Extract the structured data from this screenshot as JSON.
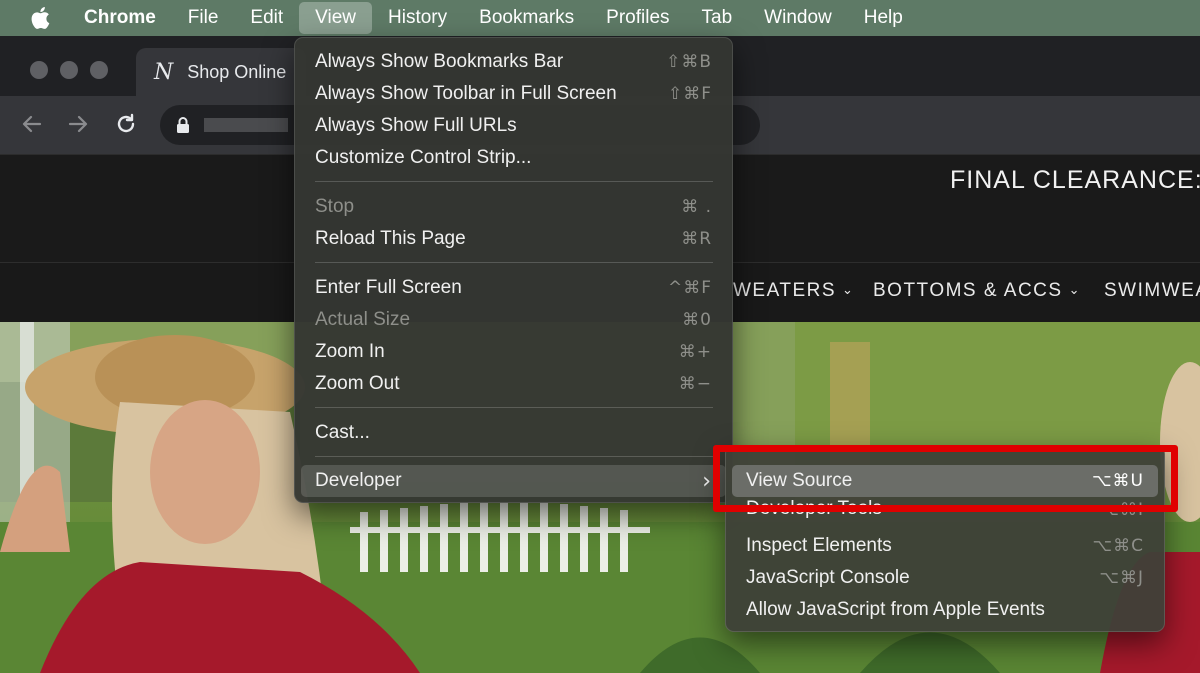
{
  "menubar": {
    "app": "Chrome",
    "items": [
      "File",
      "Edit",
      "View",
      "History",
      "Bookmarks",
      "Profiles",
      "Tab",
      "Window",
      "Help"
    ],
    "open_menu": "View",
    "background": "#5e7a66"
  },
  "browser": {
    "tab_favicon": "N",
    "tab_title": "Shop Online"
  },
  "site": {
    "banner_text": "FINAL CLEARANCE: F",
    "nav": [
      "WEATERS",
      "BOTTOMS & ACCS",
      "SWIMWEA"
    ]
  },
  "view_menu": {
    "always_show_bookmarks_bar": {
      "label": "Always Show Bookmarks Bar",
      "shortcut": "⇧⌘B"
    },
    "always_show_toolbar": {
      "label": "Always Show Toolbar in Full Screen",
      "shortcut": "⇧⌘F"
    },
    "always_show_full_urls": {
      "label": "Always Show Full URLs",
      "shortcut": ""
    },
    "customize_control_strip": {
      "label": "Customize Control Strip...",
      "shortcut": ""
    },
    "stop": {
      "label": "Stop",
      "shortcut": "⌘ ."
    },
    "reload": {
      "label": "Reload This Page",
      "shortcut": "⌘R"
    },
    "enter_full_screen": {
      "label": "Enter Full Screen",
      "shortcut": "^⌘F"
    },
    "actual_size": {
      "label": "Actual Size",
      "shortcut": "⌘0"
    },
    "zoom_in": {
      "label": "Zoom In",
      "shortcut": "⌘+"
    },
    "zoom_out": {
      "label": "Zoom Out",
      "shortcut": "⌘−"
    },
    "cast": {
      "label": "Cast...",
      "shortcut": ""
    },
    "developer": {
      "label": "Developer",
      "shortcut": "›"
    }
  },
  "developer_menu": {
    "view_source": {
      "label": "View Source",
      "shortcut": "⌥⌘U"
    },
    "developer_tools": {
      "label": "Developer Tools",
      "shortcut": "⌥⌘I"
    },
    "inspect_elements": {
      "label": "Inspect Elements",
      "shortcut": "⌥⌘C"
    },
    "javascript_console": {
      "label": "JavaScript Console",
      "shortcut": "⌥⌘J"
    },
    "allow_js_apple_events": {
      "label": "Allow JavaScript from Apple Events",
      "shortcut": ""
    }
  },
  "colors": {
    "highlight_box": "#e00000"
  }
}
